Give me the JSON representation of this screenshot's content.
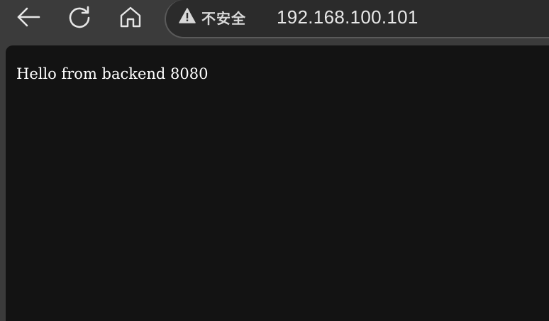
{
  "toolbar": {
    "back": {
      "icon": "arrow-left-icon"
    },
    "reload": {
      "icon": "reload-icon"
    },
    "home": {
      "icon": "home-icon"
    }
  },
  "address_bar": {
    "security_icon": "warning-triangle-icon",
    "security_label": "不安全",
    "url": "192.168.100.101"
  },
  "page": {
    "body_text": "Hello from backend 8080"
  },
  "colors": {
    "chrome_bg": "#3b3b3b",
    "address_bg": "#2b2b2b",
    "page_bg": "#131313",
    "page_text": "#ffffff"
  }
}
